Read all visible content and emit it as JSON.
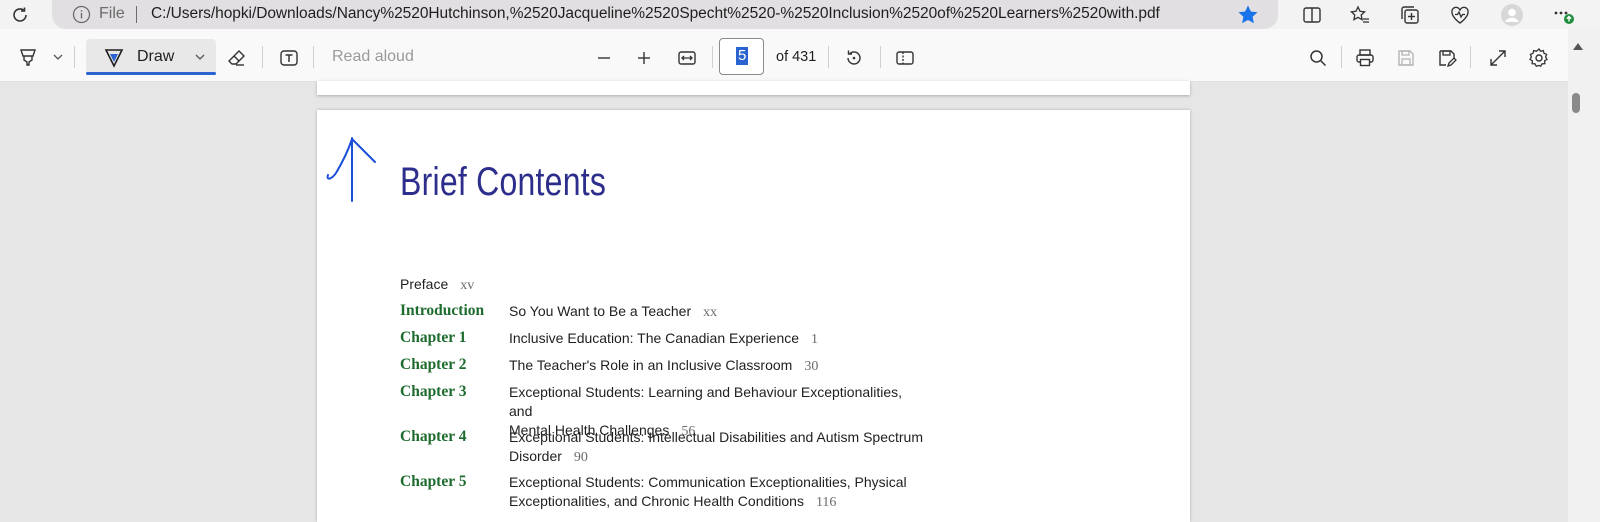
{
  "address_bar": {
    "file_label": "File",
    "url": "C:/Users/hopki/Downloads/Nancy%2520Hutchinson,%2520Jacqueline%2520Specht%2520-%2520Inclusion%2520of%2520Learners%2520with.pdf"
  },
  "pdf_toolbar": {
    "draw_label": "Draw",
    "read_aloud_label": "Read aloud",
    "current_page": "5",
    "page_total": "of 431"
  },
  "document": {
    "title": "Brief Contents",
    "preface": {
      "label": "Preface",
      "page": "xv"
    },
    "entries": [
      {
        "chapter": "Introduction",
        "line1": "So You Want to Be a Teacher",
        "line2": "",
        "page": "xx"
      },
      {
        "chapter": "Chapter 1",
        "line1": "Inclusive Education: The Canadian Experience",
        "line2": "",
        "page": "1"
      },
      {
        "chapter": "Chapter 2",
        "line1": "The Teacher's Role in an Inclusive Classroom",
        "line2": "",
        "page": "30"
      },
      {
        "chapter": "Chapter 3",
        "line1": "Exceptional Students: Learning and Behaviour Exceptionalities, and",
        "line2": "Mental Health Challenges",
        "page": "56"
      },
      {
        "chapter": "Chapter 4",
        "line1": "Exceptional Students: Intellectual Disabilities and Autism Spectrum",
        "line2": "Disorder",
        "page": "90"
      },
      {
        "chapter": "Chapter 5",
        "line1": "Exceptional Students: Communication Exceptionalities, Physical",
        "line2": "Exceptionalities, and Chronic Health Conditions",
        "page": "116"
      }
    ]
  },
  "colors": {
    "accent_blue": "#2b63d1",
    "title_navy": "#2d2d8c",
    "chapter_green": "#1e6b2e",
    "ink_blue": "#1c4fd8"
  }
}
